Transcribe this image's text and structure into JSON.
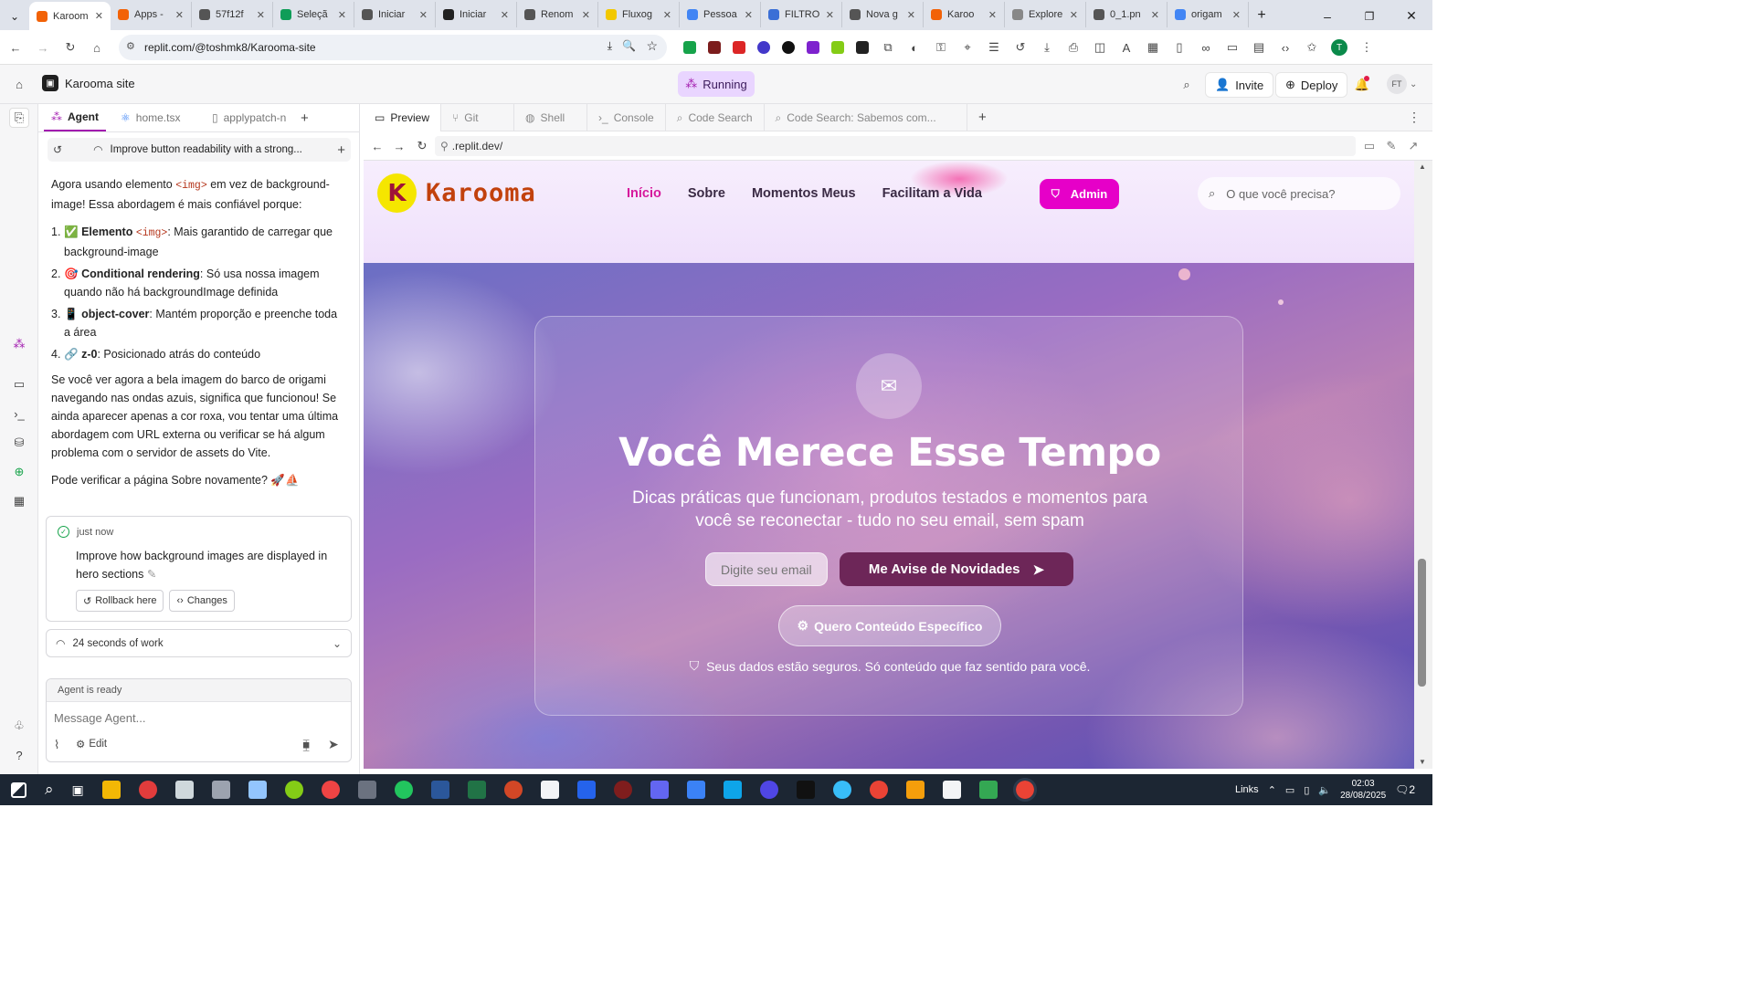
{
  "browser": {
    "tabs": [
      {
        "label": "Karoom",
        "color": "#f26207",
        "active": true
      },
      {
        "label": "Apps -",
        "color": "#f26207"
      },
      {
        "label": "57f12f",
        "color": "#555"
      },
      {
        "label": "Seleçã",
        "color": "#0f9d58"
      },
      {
        "label": "Iniciar",
        "color": "#555"
      },
      {
        "label": "Iniciar",
        "color": "#222"
      },
      {
        "label": "Renom",
        "color": "#555"
      },
      {
        "label": "Fluxog",
        "color": "#f2c800"
      },
      {
        "label": "Pessoa",
        "color": "#4285f4"
      },
      {
        "label": "FILTRO",
        "color": "#3b6fd6"
      },
      {
        "label": "Nova g",
        "color": "#555"
      },
      {
        "label": "Karoo",
        "color": "#f26207"
      },
      {
        "label": "Explore",
        "color": "#888"
      },
      {
        "label": "0_1.pn",
        "color": "#555"
      },
      {
        "label": "origam",
        "color": "#4285f4"
      }
    ],
    "url": "replit.com/@toshmk8/Karooma-site"
  },
  "replit": {
    "project": "Karooma site",
    "status": "Running",
    "invite": "Invite",
    "deploy": "Deploy",
    "avatar": "FT"
  },
  "left_tabs": {
    "agent": "Agent",
    "file": "home.tsx",
    "patch": "applypatch-n"
  },
  "agent": {
    "checkpoint": "Improve button readability with a strong...",
    "intro_a": "Agora usando elemento",
    "intro_code": "<img>",
    "intro_b": "em vez de background-image! Essa abordagem é mais confiável porque:",
    "items": [
      {
        "n": "1.",
        "emoji": "✅",
        "bold": "Elemento",
        "code": "<img>",
        "text": ": Mais garantido de carregar que background-image"
      },
      {
        "n": "2.",
        "emoji": "🎯",
        "bold": "Conditional rendering",
        "code": "",
        "text": ": Só usa nossa imagem quando não há backgroundImage definida"
      },
      {
        "n": "3.",
        "emoji": "📱",
        "bold": "object-cover",
        "code": "",
        "text": ": Mantém proporção e preenche toda a área"
      },
      {
        "n": "4.",
        "emoji": "🔗",
        "bold": "z-0",
        "code": "",
        "text": ": Posicionado atrás do conteúdo"
      }
    ],
    "para2": "Se você ver agora a bela imagem do barco de origami navegando nas ondas azuis, significa que funcionou! Se ainda aparecer apenas a cor roxa, vou tentar uma última abordagem com URL externa ou verificar se há algum problema com o servidor de assets do Vite.",
    "para3": "Pode verificar a página Sobre novamente? 🚀⛵",
    "time": "just now",
    "change_title": "Improve how background images are displayed in hero sections",
    "rollback": "Rollback here",
    "changes": "Changes",
    "work": "24 seconds of work",
    "ready": "Agent is ready",
    "placeholder": "Message Agent...",
    "edit": "Edit"
  },
  "pane_tabs": [
    "Preview",
    "Git",
    "Shell",
    "Console",
    "Code Search",
    "Code Search: Sabemos com..."
  ],
  "preview_url": ".replit.dev/",
  "site": {
    "brand": "Karooma",
    "nav": [
      "Início",
      "Sobre",
      "Momentos Meus",
      "Facilitam a Vida"
    ],
    "admin": "Admin",
    "search_placeholder": "O que você precisa?",
    "hero_title": "Você Merece Esse Tempo",
    "hero_sub": "Dicas práticas que funcionam, produtos testados e momentos para você se reconectar - tudo no seu email, sem spam",
    "email_placeholder": "Digite seu email",
    "cta": "Me Avise de Novidades",
    "cta2": "Quero Conteúdo Específico",
    "privacy": "Seus dados estão seguros. Só conteúdo que faz sentido para você."
  },
  "taskbar": {
    "links": "Links",
    "time": "02:03",
    "date": "28/08/2025",
    "notif": "2"
  }
}
